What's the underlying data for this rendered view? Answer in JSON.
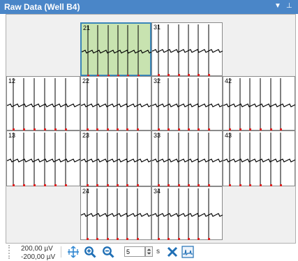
{
  "window": {
    "title": "Raw Data (Well B4)"
  },
  "electrodes": [
    {
      "label": "21",
      "selected": true
    },
    {
      "label": "31",
      "selected": false
    },
    {
      "label": "12",
      "selected": false
    },
    {
      "label": "22",
      "selected": false
    },
    {
      "label": "32",
      "selected": false
    },
    {
      "label": "42",
      "selected": false
    },
    {
      "label": "13",
      "selected": false
    },
    {
      "label": "23",
      "selected": false
    },
    {
      "label": "33",
      "selected": false
    },
    {
      "label": "43",
      "selected": false
    },
    {
      "label": "24",
      "selected": false
    },
    {
      "label": "34",
      "selected": false
    }
  ],
  "toolbar": {
    "scale_top": "200,00 µV",
    "scale_bottom": "-200,00 µV",
    "time_value": "5",
    "time_unit": "s"
  },
  "colors": {
    "accent": "#4a86c8",
    "selection_fill": "#c8e3b0",
    "selection_border": "#3a85b8",
    "spike_marker": "#e02020",
    "trace": "#000000"
  }
}
